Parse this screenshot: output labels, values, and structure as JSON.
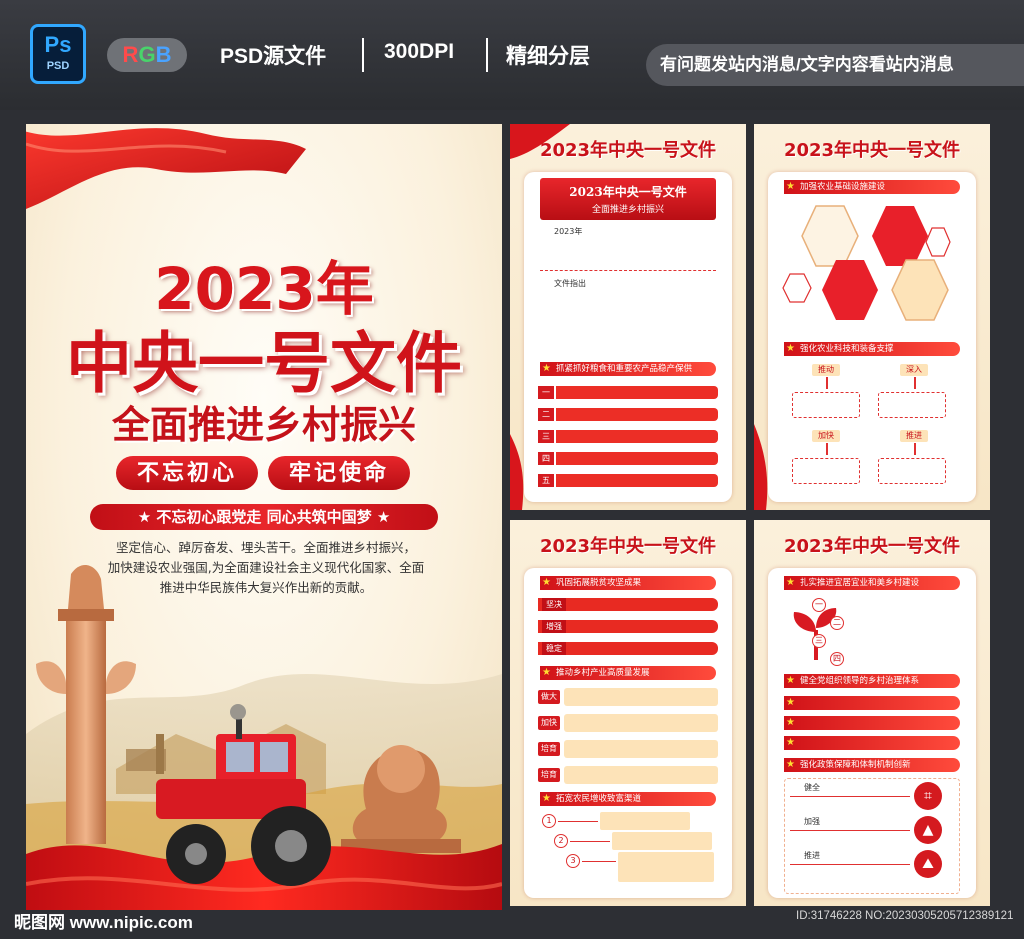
{
  "banner": {
    "ps_logo": {
      "big": "Ps",
      "small": "PSD"
    },
    "rgb": [
      "R",
      "G",
      "B"
    ],
    "labels": [
      "PSD源文件",
      "300DPI",
      "精细分层"
    ],
    "notice": "有问题发站内消息/文字内容看站内消息"
  },
  "main_poster": {
    "year": "2023年",
    "title": "中央一号文件",
    "subtitle": "全面推进乡村振兴",
    "slogans": [
      "不忘初心",
      "牢记使命"
    ],
    "motto": "★ 不忘初心跟党走  同心共筑中国梦 ★",
    "body_lines": [
      "坚定信心、踔厉奋发、埋头苦干。全面推进乡村振兴，",
      "加快建设农业强国,为全面建设社会主义现代化国家、全面",
      "推进中华民族伟大复兴作出新的贡献。"
    ]
  },
  "panel_title": "2023年中央一号文件",
  "panel1": {
    "banner_title": "2023年中央一号文件",
    "banner_sub": "全面推进乡村振兴",
    "label_year": "2023年",
    "label_doc": "文件指出",
    "section": "抓紧抓好粮食和重要农产品稳产保供",
    "numbers": [
      "一",
      "二",
      "三",
      "四",
      "五"
    ]
  },
  "panel2": {
    "section1": "加强农业基础设施建设",
    "section2": "强化农业科技和装备支撑",
    "flow_labels": [
      "推动",
      "深入",
      "加快",
      "推进"
    ]
  },
  "panel3": {
    "section1": "巩固拓展脱贫攻坚成果",
    "tags1": [
      "坚决",
      "增强",
      "稳定"
    ],
    "section2": "推动乡村产业高质量发展",
    "tags2": [
      "做大",
      "加快",
      "培育",
      "培育"
    ],
    "section3": "拓宽农民增收致富渠道",
    "nums": [
      "1",
      "2",
      "3"
    ]
  },
  "panel4": {
    "section1": "扎实推进宜居宜业和美乡村建设",
    "circle_nums": [
      "一",
      "二",
      "三",
      "四"
    ],
    "section2": "健全党组织领导的乡村治理体系",
    "section3": "强化政策保障和体制机制创新",
    "flow_labels": [
      "健全",
      "加强",
      "推进"
    ],
    "icons": [
      "network-icon",
      "graduation-cap-icon",
      "mountain-icon"
    ]
  },
  "footer": {
    "watermark": "昵图网 www.nipic.com",
    "docid": "ID:31746228 NO:20230305205712389121"
  },
  "colors": {
    "accent_red": "#d8161c",
    "cream": "#fbf0db",
    "dark_bg": "#2d2f34"
  }
}
